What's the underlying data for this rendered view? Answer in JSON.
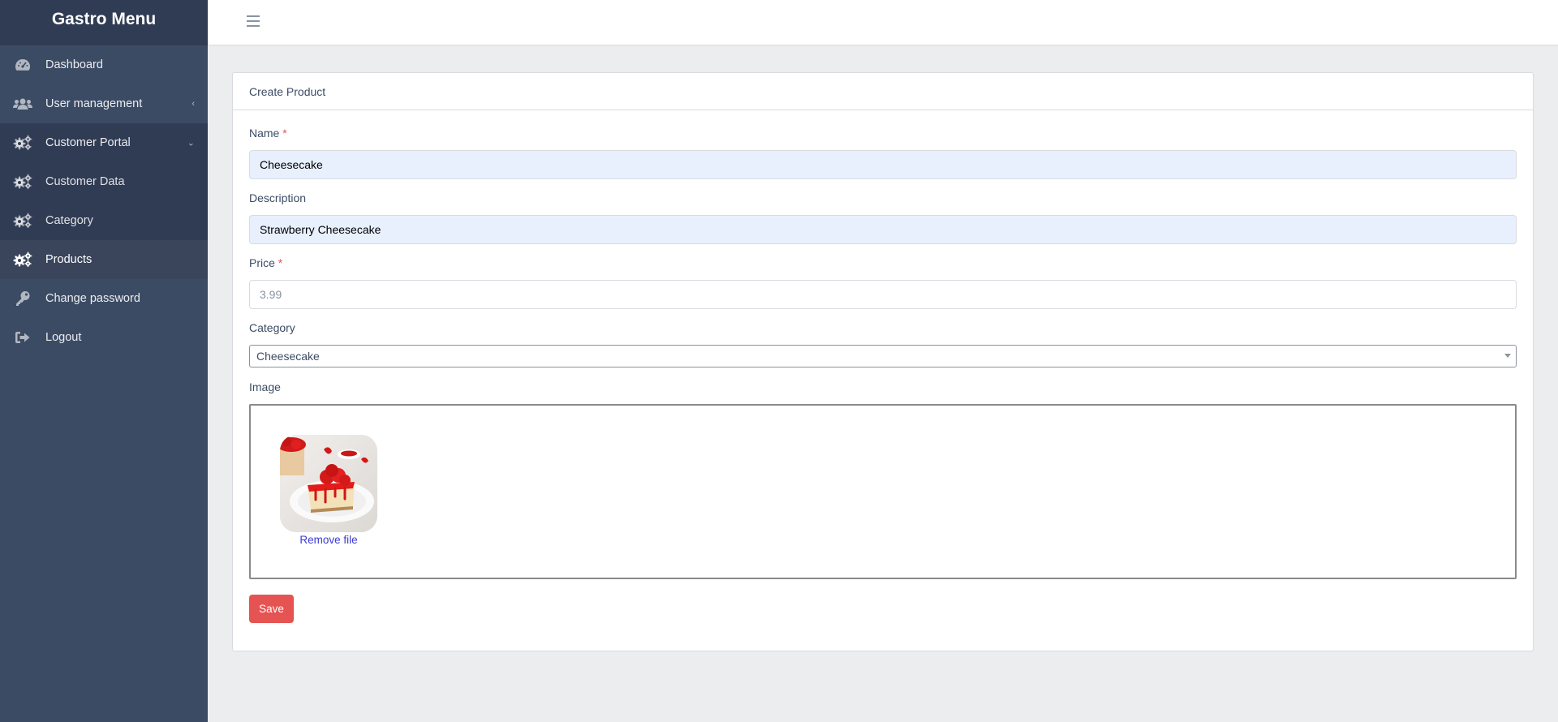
{
  "app": {
    "brand": "Gastro Menu"
  },
  "sidebar": {
    "items": [
      {
        "label": "Dashboard",
        "icon": "speedometer-icon"
      },
      {
        "label": "User management",
        "icon": "users-icon",
        "caret": "‹"
      },
      {
        "label": "Customer Portal",
        "icon": "gears-icon",
        "caret": "⌄"
      },
      {
        "label": "Customer Data",
        "icon": "gears-icon"
      },
      {
        "label": "Category",
        "icon": "gears-icon"
      },
      {
        "label": "Products",
        "icon": "gears-icon",
        "active": true
      },
      {
        "label": "Change password",
        "icon": "key-icon"
      },
      {
        "label": "Logout",
        "icon": "logout-icon"
      }
    ]
  },
  "header": {
    "menu_icon": "hamburger-icon"
  },
  "form": {
    "title": "Create Product",
    "name": {
      "label": "Name",
      "required_mark": "*",
      "value": "Cheesecake"
    },
    "description": {
      "label": "Description",
      "value": "Strawberry Cheesecake"
    },
    "price": {
      "label": "Price",
      "required_mark": "*",
      "value": "3.99"
    },
    "category": {
      "label": "Category",
      "selected": "Cheesecake"
    },
    "image": {
      "label": "Image",
      "remove_label": "Remove file",
      "thumbnail": "strawberry-cheesecake-photo"
    },
    "save_label": "Save"
  },
  "colors": {
    "sidebar": "#3c4b64",
    "sidebar_dark": "#303c54",
    "save_button": "#e55353",
    "autofill": "#e8f0fe",
    "link": "#3a3ad6"
  }
}
